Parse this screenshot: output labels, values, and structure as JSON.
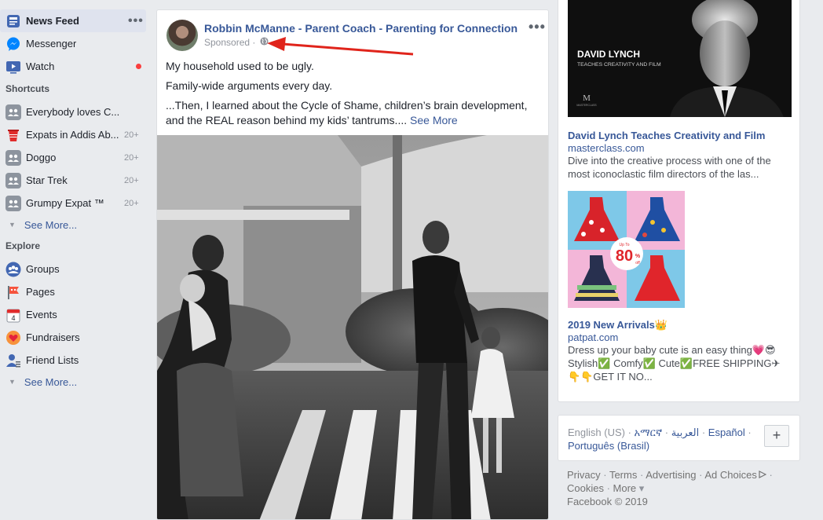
{
  "nav": {
    "top": [
      {
        "label": "News Feed",
        "more": "•••"
      },
      {
        "label": "Messenger"
      },
      {
        "label": "Watch"
      }
    ],
    "shortcuts_title": "Shortcuts",
    "shortcuts": [
      {
        "label": "Everybody loves C...",
        "count": ""
      },
      {
        "label": "Expats in Addis Ab...",
        "count": "20+"
      },
      {
        "label": "Doggo",
        "count": "20+"
      },
      {
        "label": "Star Trek",
        "count": "20+"
      },
      {
        "label": "Grumpy Expat ™",
        "count": "20+"
      }
    ],
    "see_more": "See More...",
    "explore_title": "Explore",
    "explore": [
      {
        "label": "Groups"
      },
      {
        "label": "Pages"
      },
      {
        "label": "Events",
        "icon_text": "4"
      },
      {
        "label": "Fundraisers"
      },
      {
        "label": "Friend Lists"
      }
    ],
    "see_more2": "See More..."
  },
  "post": {
    "author": "Robbin McManne - Parent Coach - Parenting for Connection",
    "menu": "•••",
    "sponsored": "Sponsored ·",
    "line1": "My household used to be ugly.",
    "line2": "Family-wide arguments every day.",
    "line3": "...Then, I learned about the Cycle of Shame, children’s brain development, and the REAL reason behind my kids’ tantrums....",
    "see_more": "See More"
  },
  "ads": {
    "ad1": {
      "img_title": "DAVID LYNCH",
      "img_sub": "TEACHES CREATIVITY AND FILM",
      "img_logo": "M",
      "img_brand": "MASTERCLASS",
      "title": "David Lynch Teaches Creativity and Film",
      "domain": "masterclass.com",
      "desc": "Dive into the creative process with one of the most iconoclastic film directors of the las..."
    },
    "ad2": {
      "badge_top": "Up To",
      "badge_pct": "80",
      "badge_unit": "%",
      "badge_off": "off",
      "title": "2019 New Arrivals👑",
      "domain": "patpat.com",
      "desc": "Dress up your baby cute is an easy thing💗😎 Stylish✅ Comfy✅ Cute✅FREE SHIPPING✈ 👇👇GET IT NO..."
    }
  },
  "languages": {
    "current": "English (US)",
    "list": [
      "አማርኛ",
      "العربية",
      "Español",
      "Português (Brasil)"
    ],
    "add": "+"
  },
  "footer": {
    "links": [
      "Privacy",
      "Terms",
      "Advertising",
      "Ad Choices",
      "Cookies",
      "More"
    ],
    "more_arrow": "▾",
    "copyright": "Facebook © 2019"
  },
  "colors": {
    "brand_link": "#385898",
    "background": "#e9ebee",
    "notification": "#fa3e3e",
    "annotation_arrow": "#e0241b"
  }
}
